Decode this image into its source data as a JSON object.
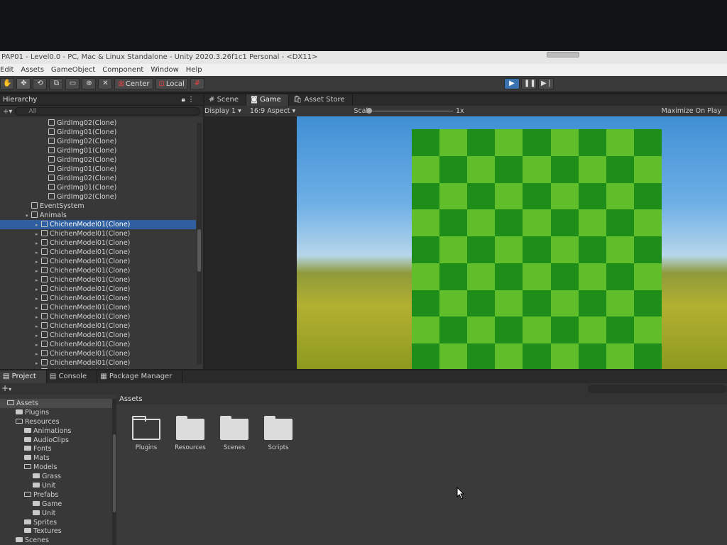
{
  "window": {
    "title": "PAP01 - Level0.0 - PC, Mac & Linux Standalone - Unity 2020.3.26f1c1 Personal - <DX11>"
  },
  "menu": [
    "Edit",
    "Assets",
    "GameObject",
    "Component",
    "Window",
    "Help"
  ],
  "toolbar": {
    "pivot_label": "Center",
    "space_label": "Local"
  },
  "hierarchy": {
    "tab_label": "Hierarchy",
    "search_placeholder": "All",
    "rows": [
      {
        "label": "GirdImg02(Clone)",
        "indent": 60
      },
      {
        "label": "GirdImg01(Clone)",
        "indent": 60
      },
      {
        "label": "GirdImg02(Clone)",
        "indent": 60
      },
      {
        "label": "GirdImg01(Clone)",
        "indent": 60
      },
      {
        "label": "GirdImg02(Clone)",
        "indent": 60
      },
      {
        "label": "GirdImg01(Clone)",
        "indent": 60
      },
      {
        "label": "GirdImg02(Clone)",
        "indent": 60
      },
      {
        "label": "GirdImg01(Clone)",
        "indent": 60
      },
      {
        "label": "GirdImg02(Clone)",
        "indent": 60
      },
      {
        "label": "EventSystem",
        "indent": 36
      },
      {
        "label": "Animals",
        "indent": 36,
        "expanded": true
      },
      {
        "label": "ChichenModel01(Clone)",
        "indent": 50,
        "selected": true
      },
      {
        "label": "ChichenModel01(Clone)",
        "indent": 50
      },
      {
        "label": "ChichenModel01(Clone)",
        "indent": 50
      },
      {
        "label": "ChichenModel01(Clone)",
        "indent": 50
      },
      {
        "label": "ChichenModel01(Clone)",
        "indent": 50
      },
      {
        "label": "ChichenModel01(Clone)",
        "indent": 50
      },
      {
        "label": "ChichenModel01(Clone)",
        "indent": 50
      },
      {
        "label": "ChichenModel01(Clone)",
        "indent": 50
      },
      {
        "label": "ChichenModel01(Clone)",
        "indent": 50
      },
      {
        "label": "ChichenModel01(Clone)",
        "indent": 50
      },
      {
        "label": "ChichenModel01(Clone)",
        "indent": 50
      },
      {
        "label": "ChichenModel01(Clone)",
        "indent": 50
      },
      {
        "label": "ChichenModel01(Clone)",
        "indent": 50
      },
      {
        "label": "ChichenModel01(Clone)",
        "indent": 50
      },
      {
        "label": "ChichenModel01(Clone)",
        "indent": 50
      },
      {
        "label": "ChichenModel01(Clone)",
        "indent": 50
      },
      {
        "label": "ChichenModel01(Clone)",
        "indent": 50
      }
    ]
  },
  "game_view": {
    "tabs": [
      "Scene",
      "Game",
      "Asset Store"
    ],
    "display": "Display 1",
    "aspect": "16:9 Aspect",
    "scale_label": "Scale",
    "scale_value": "1x",
    "maximize": "Maximize On Play"
  },
  "project": {
    "tabs": [
      "Project",
      "Console",
      "Package Manager"
    ],
    "add_label": "+",
    "header": "Assets",
    "tree": [
      {
        "label": "Assets",
        "indent": 10,
        "open": true
      },
      {
        "label": "Plugins",
        "indent": 22
      },
      {
        "label": "Resources",
        "indent": 22,
        "open": true
      },
      {
        "label": "Animations",
        "indent": 34
      },
      {
        "label": "AudioClips",
        "indent": 34
      },
      {
        "label": "Fonts",
        "indent": 34
      },
      {
        "label": "Mats",
        "indent": 34
      },
      {
        "label": "Models",
        "indent": 34,
        "open": true
      },
      {
        "label": "Grass",
        "indent": 46
      },
      {
        "label": "Unit",
        "indent": 46
      },
      {
        "label": "Prefabs",
        "indent": 34,
        "open": true
      },
      {
        "label": "Game",
        "indent": 46
      },
      {
        "label": "Unit",
        "indent": 46
      },
      {
        "label": "Sprites",
        "indent": 34
      },
      {
        "label": "Textures",
        "indent": 34
      },
      {
        "label": "Scenes",
        "indent": 22
      }
    ],
    "assets": [
      {
        "label": "Plugins",
        "style": "outline"
      },
      {
        "label": "Resources",
        "style": "filled"
      },
      {
        "label": "Scenes",
        "style": "filled"
      },
      {
        "label": "Scripts",
        "style": "filled"
      }
    ]
  }
}
